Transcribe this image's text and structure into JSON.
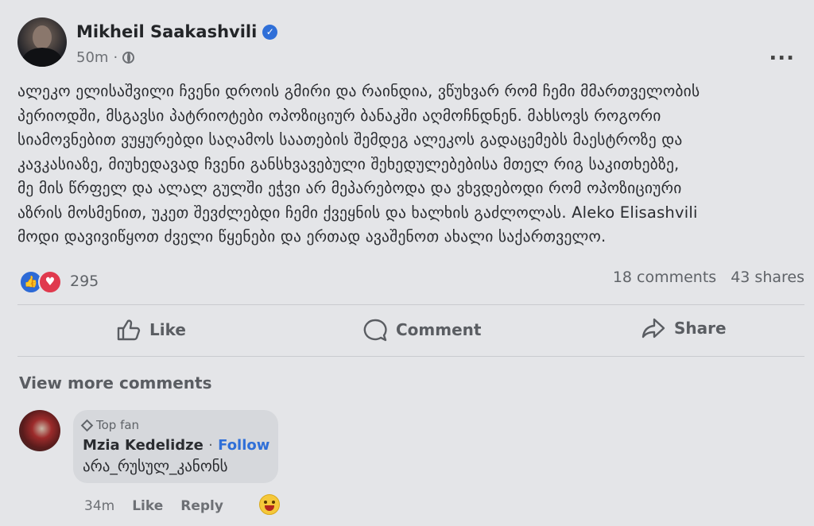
{
  "post": {
    "author": "Mikheil Saakashvili",
    "time": "50m",
    "more_label": "...",
    "text_lines": [
      "ალეკო ელისაშვილი ჩვენი დროის გმირი და რაინდია, ვწუხვარ რომ ჩემი მმართველობის",
      "პერიოდში, მსგავსი პატრიოტები ოპოზიციურ ბანაკში აღმოჩნდნენ. მახსოვს როგორი",
      "სიამოვნებით ვუყურებდი საღამოს საათების შემდეგ ალეკოს გადაცემებს მაესტროზე და",
      "კავკასიაზე, მიუხედავად ჩვენი განსხვავებული შეხედულებებისა მთელ რიგ საკითხებზე,",
      "მე მის წრფელ და ალალ გულში ეჭვი არ მეპარებოდა და ვხვდებოდი რომ ოპოზიციური",
      "აზრის მოსმენით, უკეთ შევძლებდი ჩემი ქვეყნის და ხალხის გაძლოლას. Aleko Elisashvili",
      "მოდი დავივიწყოთ ძველი წყენები და ერთად ავაშენოთ ახალი საქართველო."
    ]
  },
  "stats": {
    "reaction_count": "295",
    "comments": "18 comments",
    "shares": "43 shares"
  },
  "actions": {
    "like": "Like",
    "comment": "Comment",
    "share": "Share"
  },
  "view_more": "View more comments",
  "comment": {
    "badge": "Top fan",
    "name": "Mzia Kedelidze",
    "separator": "·",
    "follow": "Follow",
    "text": "არა_რუსულ_კანონს",
    "time": "34m",
    "like": "Like",
    "reply": "Reply"
  },
  "colors": {
    "background": "#e4e5e8",
    "accent_blue": "#2f6fd8",
    "love_red": "#e03a4e"
  }
}
